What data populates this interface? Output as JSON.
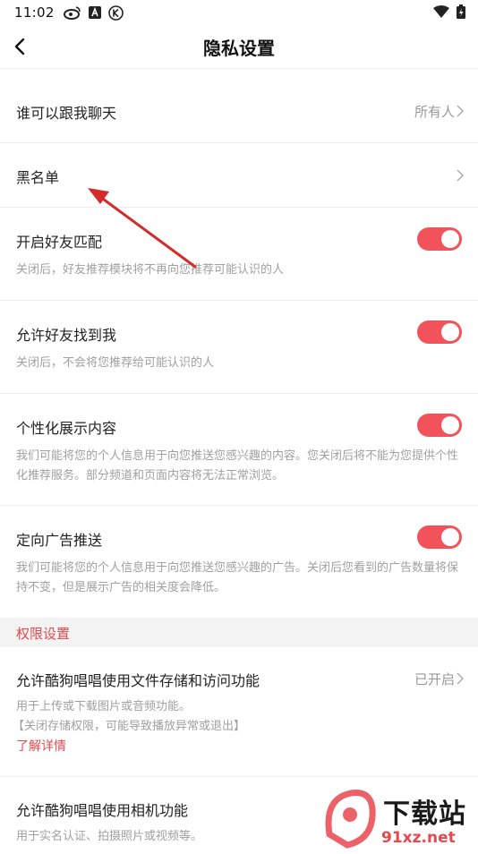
{
  "status_bar": {
    "time": "11:02"
  },
  "header": {
    "title": "隐私设置"
  },
  "rows": {
    "chat": {
      "title": "谁可以跟我聊天",
      "value": "所有人"
    },
    "blacklist": {
      "title": "黑名单"
    },
    "friend_match": {
      "title": "开启好友匹配",
      "desc": "关闭后，好友推荐模块将不再向您推荐可能认识的人",
      "enabled": true
    },
    "find_me": {
      "title": "允许好友找到我",
      "desc": "关闭后，不会将您推荐给可能认识的人",
      "enabled": true
    },
    "personalized": {
      "title": "个性化展示内容",
      "desc": "我们可能将您的个人信息用于向您推送您感兴趣的内容。您关闭后将不能为您提供个性化推荐服务。部分频道和页面内容将无法正常浏览。",
      "enabled": true
    },
    "ads": {
      "title": "定向广告推送",
      "desc": "我们可能将您的个人信息用于向您推送您感兴趣的广告。关闭后您看到的广告数量将保持不变，但是展示广告的相关度会降低。",
      "enabled": true
    }
  },
  "permissions": {
    "section_title": "权限设置",
    "storage": {
      "title": "允许酷狗唱唱使用文件存储和访问功能",
      "value": "已开启",
      "desc1": "用于上传或下载图片或音频功能。",
      "desc2": "【关闭存储权限，可能导致播放异常或退出】",
      "link": "了解详情"
    },
    "camera": {
      "title": "允许酷狗唱唱使用相机功能",
      "desc": "用于实名认证、拍摄照片或视频等。"
    }
  },
  "watermark": {
    "text1": "下载站",
    "text2": "91xz.net"
  },
  "colors": {
    "accent": "#f2535b",
    "link": "#e8484f"
  }
}
